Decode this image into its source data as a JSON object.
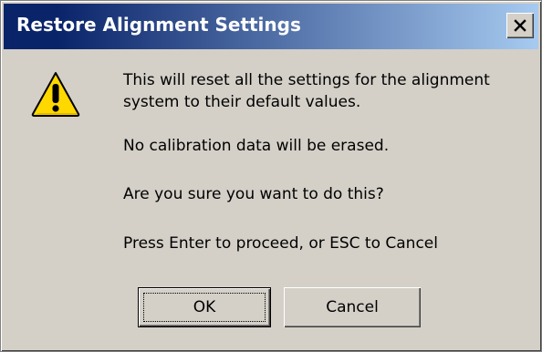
{
  "window": {
    "title": "Restore Alignment Settings",
    "close_icon": "close-icon",
    "close_glyph": "✕"
  },
  "icon": {
    "name": "warning-icon",
    "glyph": "!",
    "color": "#ffd800"
  },
  "message": {
    "line1": "This will reset all the settings for the alignment system to their default values.",
    "line2": "No calibration data will be erased.",
    "line3": "Are you sure you want to do this?",
    "line4": "Press Enter to proceed, or ESC to Cancel"
  },
  "buttons": {
    "ok_label": "OK",
    "cancel_label": "Cancel"
  },
  "colors": {
    "titlebar_start": "#0a246a",
    "titlebar_end": "#a6caf0",
    "dialog_bg": "#d4d0c8"
  }
}
